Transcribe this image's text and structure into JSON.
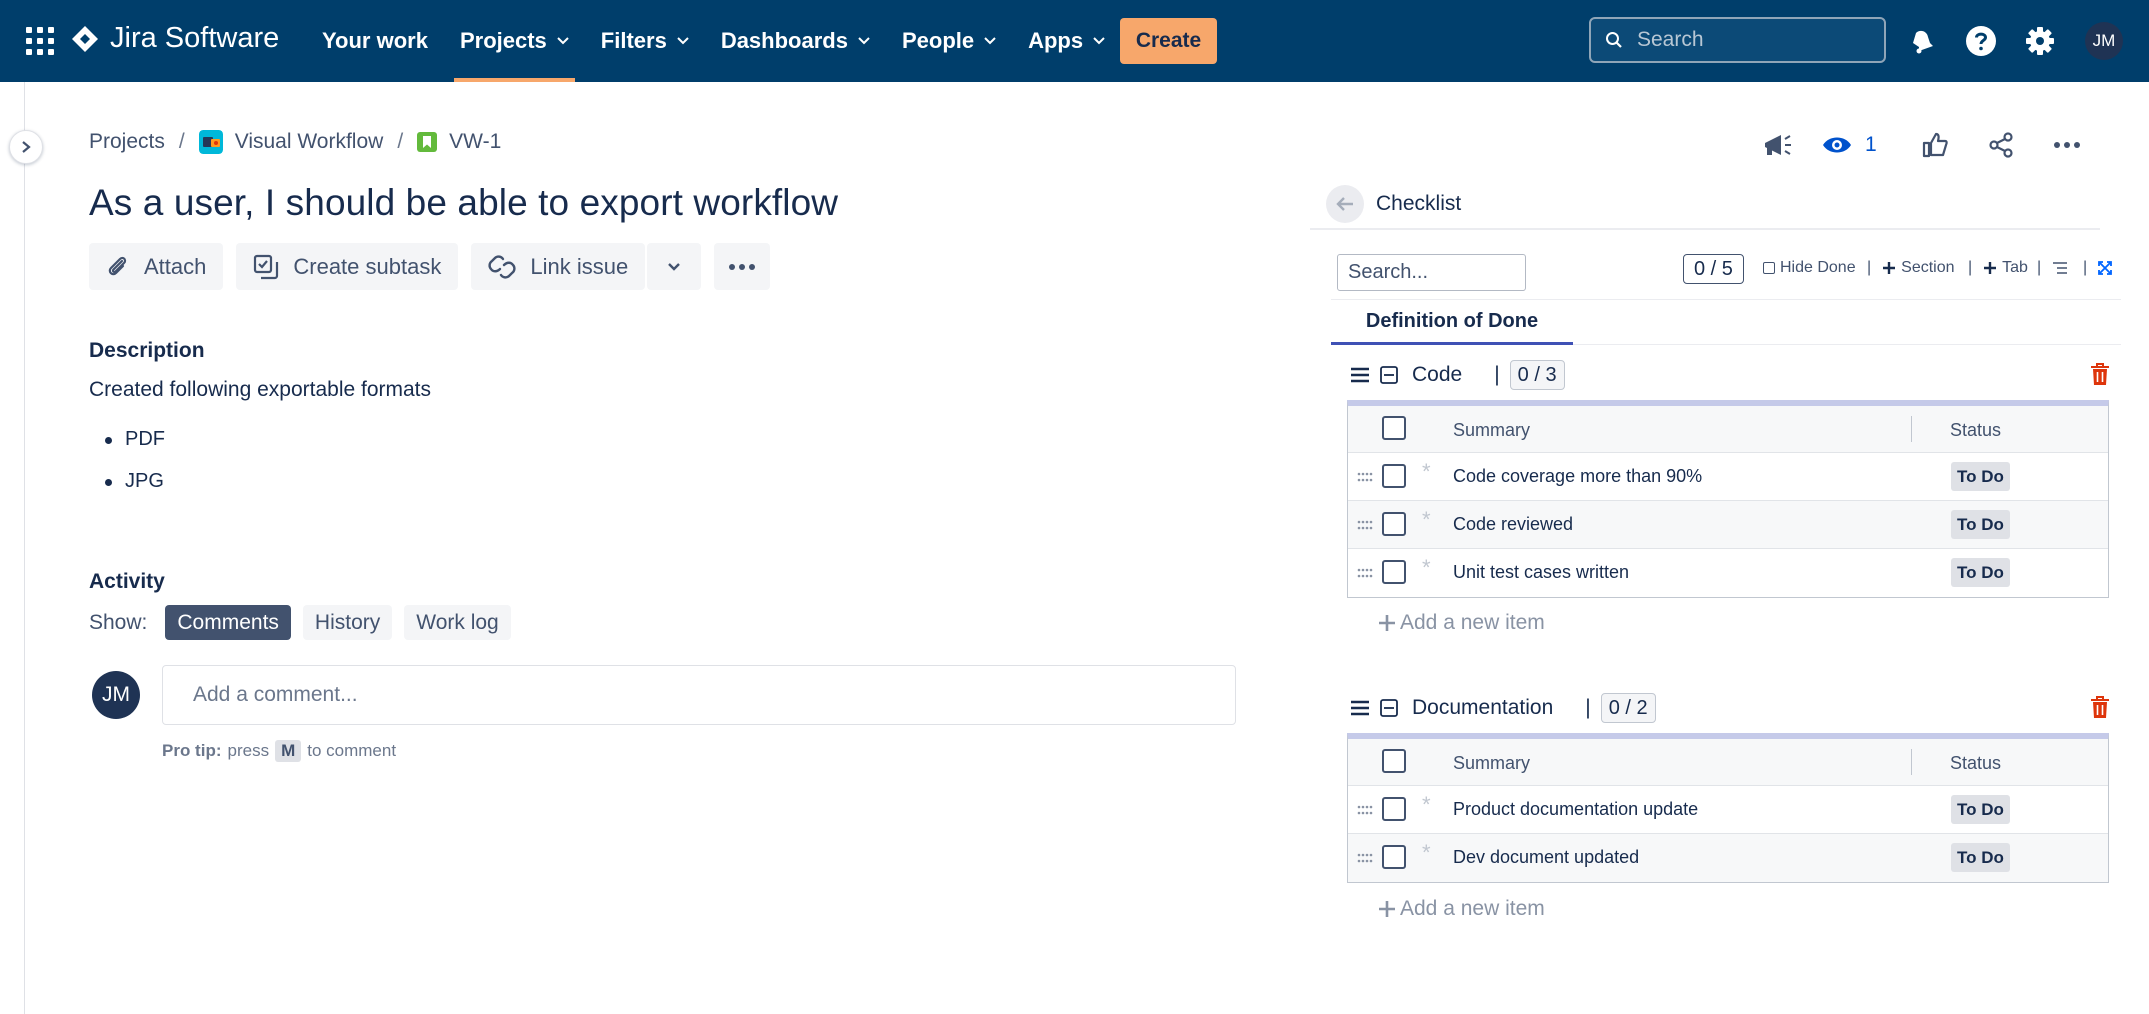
{
  "app": {
    "name": "Jira Software",
    "colors": {
      "nav_bg": "#003e6b",
      "create_bg": "#f7a76b",
      "accent": "#0052cc",
      "delete": "#de350b",
      "tab_underline": "#3f51b5"
    }
  },
  "nav": {
    "items": [
      {
        "label": "Your work",
        "dropdown": false
      },
      {
        "label": "Projects",
        "dropdown": true,
        "active": true
      },
      {
        "label": "Filters",
        "dropdown": true
      },
      {
        "label": "Dashboards",
        "dropdown": true
      },
      {
        "label": "People",
        "dropdown": true
      },
      {
        "label": "Apps",
        "dropdown": true
      }
    ],
    "create_label": "Create",
    "search_placeholder": "Search",
    "user_initials": "JM",
    "icons": [
      "app-switcher-icon",
      "notification-icon",
      "help-icon",
      "settings-icon"
    ]
  },
  "breadcrumb": {
    "items": [
      "Projects",
      "Visual Workflow",
      "VW-1"
    ]
  },
  "issue": {
    "title": "As a user, I should be able to export workflow",
    "watchers": "1",
    "actions": {
      "attach": "Attach",
      "create_subtask": "Create subtask",
      "link_issue": "Link issue"
    },
    "description": {
      "label": "Description",
      "text": "Created following exportable formats",
      "items": [
        "PDF",
        "JPG"
      ]
    }
  },
  "activity": {
    "label": "Activity",
    "show_label": "Show:",
    "filters": [
      "Comments",
      "History",
      "Work log"
    ],
    "active_filter": "Comments",
    "comment_placeholder": "Add a comment...",
    "user_initials": "JM",
    "pro_tip": {
      "prefix": "Pro tip:",
      "press": "press",
      "key": "M",
      "suffix": "to comment"
    }
  },
  "checklist": {
    "title": "Checklist",
    "search_placeholder": "Search...",
    "progress": "0 / 5",
    "options": {
      "hide_done": "Hide Done",
      "section": "Section",
      "tab": "Tab"
    },
    "tab": "Definition of Done",
    "columns": {
      "summary": "Summary",
      "status": "Status"
    },
    "add_item_label": "Add a new item",
    "sections": [
      {
        "name": "Code",
        "count": "0 / 3",
        "items": [
          {
            "summary": "Code coverage more than 90%",
            "status": "To Do"
          },
          {
            "summary": "Code reviewed",
            "status": "To Do"
          },
          {
            "summary": "Unit test cases written",
            "status": "To Do"
          }
        ]
      },
      {
        "name": "Documentation",
        "count": "0 / 2",
        "items": [
          {
            "summary": "Product documentation update",
            "status": "To Do"
          },
          {
            "summary": "Dev document updated",
            "status": "To Do"
          }
        ]
      }
    ]
  }
}
